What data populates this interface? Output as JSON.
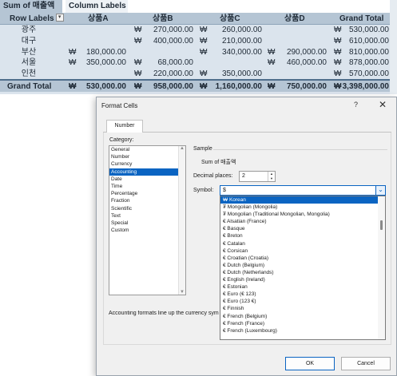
{
  "pivot": {
    "values_field": "Sum of 매출액",
    "column_labels": "Column Labels",
    "row_labels": "Row Labels",
    "currency": "₩",
    "columns": [
      "상품A",
      "상품B",
      "상품C",
      "상품D",
      "Grand Total"
    ],
    "rows": [
      {
        "label": "광주",
        "a": "",
        "b": "270,000.00",
        "c": "260,000.00",
        "d": "",
        "total": "530,000.00"
      },
      {
        "label": "대구",
        "a": "",
        "b": "400,000.00",
        "c": "210,000.00",
        "d": "",
        "total": "610,000.00"
      },
      {
        "label": "부산",
        "a": "180,000.00",
        "b": "",
        "c": "340,000.00",
        "d": "290,000.00",
        "total": "810,000.00"
      },
      {
        "label": "서울",
        "a": "350,000.00",
        "b": "68,000.00",
        "c": "",
        "d": "460,000.00",
        "total": "878,000.00"
      },
      {
        "label": "인천",
        "a": "",
        "b": "220,000.00",
        "c": "350,000.00",
        "d": "",
        "total": "570,000.00"
      }
    ],
    "grand": {
      "label": "Grand Total",
      "a": "530,000.00",
      "b": "958,000.00",
      "c": "1,160,000.00",
      "d": "750,000.00",
      "total": "3,398,000.00"
    }
  },
  "dialog": {
    "title": "Format Cells",
    "help": "?",
    "close": "✕",
    "tab": "Number",
    "category_label": "Category:",
    "categories": [
      "General",
      "Number",
      "Currency",
      "Accounting",
      "Date",
      "Time",
      "Percentage",
      "Fraction",
      "Scientific",
      "Text",
      "Special",
      "Custom"
    ],
    "selected_category": "Accounting",
    "sample_label": "Sample",
    "sample_value": "Sum of 매출액",
    "decimal_label": "Decimal places:",
    "decimal_value": "2",
    "symbol_label": "Symbol:",
    "symbol_value": "$",
    "symbols": [
      "₩ Korean",
      "₮ Mongolian (Mongolia)",
      "₮ Mongolian (Traditional Mongolian, Mongolia)",
      "€ Alsatian (France)",
      "€ Basque",
      "€ Breton",
      "€ Catalan",
      "€ Corsican",
      "€ Croatian (Croatia)",
      "€ Dutch (Belgium)",
      "€ Dutch (Netherlands)",
      "€ English (Ireland)",
      "€ Estonian",
      "€ Euro (€ 123)",
      "€ Euro (123 €)",
      "€ Finnish",
      "€ French (Belgium)",
      "€ French (France)",
      "€ French (Luxembourg)"
    ],
    "selected_symbol": "₩ Korean",
    "note": "Accounting formats line up the currency sym",
    "ok": "OK",
    "cancel": "Cancel"
  }
}
